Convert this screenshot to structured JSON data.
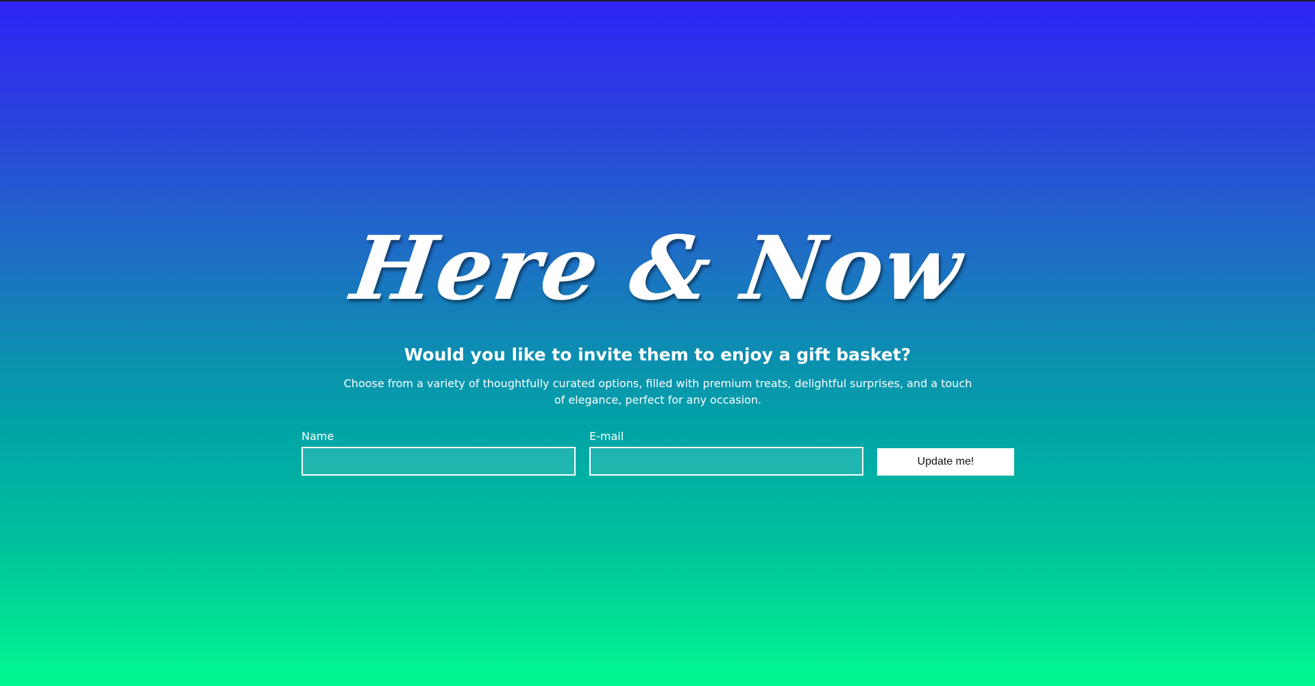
{
  "hero": {
    "brand": "Here & Now"
  },
  "invite": {
    "headline": "Would you like to invite them to enjoy a gift basket?",
    "description": "Choose from a variety of thoughtfully curated options, filled with premium treats, delightful surprises, and a touch of elegance, perfect for any occasion."
  },
  "form": {
    "name_label": "Name",
    "name_value": "",
    "email_label": "E-mail",
    "email_value": "",
    "submit_label": "Update me!"
  },
  "colors": {
    "gradient_top": "#2e24f7",
    "gradient_bottom": "#00f990",
    "button_bg": "#ffffff",
    "text": "#ffffff"
  }
}
